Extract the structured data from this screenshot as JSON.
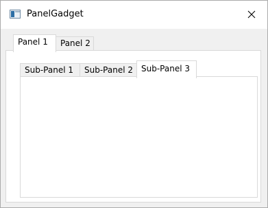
{
  "window": {
    "title": "PanelGadget",
    "icon": "window-app-icon",
    "close_icon": "close-icon"
  },
  "outer_tabs": [
    {
      "label": "Panel 1",
      "selected": true
    },
    {
      "label": "Panel 2",
      "selected": false
    }
  ],
  "inner_tabs": [
    {
      "label": "Sub-Panel 1",
      "selected": false
    },
    {
      "label": "Sub-Panel 2",
      "selected": false
    },
    {
      "label": "Sub-Panel 3",
      "selected": true
    }
  ],
  "colors": {
    "window_background": "#f0f0f0",
    "panel_background": "#ffffff",
    "border": "#d9d9d9"
  }
}
